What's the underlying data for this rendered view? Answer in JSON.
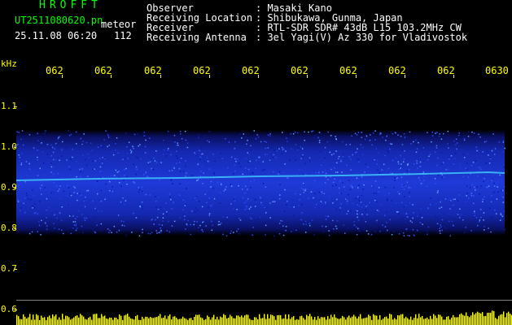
{
  "header": {
    "app_title": "HROFFT",
    "file_name": "UT2511080620.pn",
    "meteor_label": "meteor",
    "date_time": "25.11.08 06:20",
    "count": "112"
  },
  "meta": [
    {
      "key": "Observer",
      "value": ": Masaki Kano"
    },
    {
      "key": "Receiving Location",
      "value": ": Shibukawa, Gunma, Japan"
    },
    {
      "key": "Receiver",
      "value": ": RTL-SDR SDR# 43dB L15 103.2MHz CW"
    },
    {
      "key": "Receiving Antenna",
      "value": ": 3el Yagi(V) Az 330 for Vladivostok"
    }
  ],
  "axis": {
    "unit": "kHz",
    "time_labels": [
      "062",
      "062",
      "062",
      "062",
      "062",
      "062",
      "062",
      "062",
      "062",
      "0630"
    ],
    "freq_labels": [
      "1.1",
      "1.0",
      "0.9",
      "0.8",
      "0.7",
      "0.6"
    ]
  },
  "colors": {
    "background": "#000000",
    "label": "#ffff00",
    "title": "#00ff00",
    "signal_band": "#1a2fd0",
    "signal_line": "#40d0ff",
    "bottom_bars": "#ffff00"
  }
}
